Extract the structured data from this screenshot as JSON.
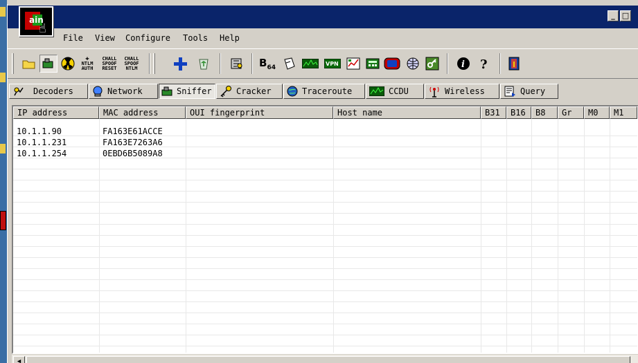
{
  "app": {
    "logo_text": "ain"
  },
  "window_buttons": {
    "minimize": "_",
    "maximize": "□"
  },
  "menu": [
    {
      "label": "File"
    },
    {
      "label": "View"
    },
    {
      "label": "Configure"
    },
    {
      "label": "Tools"
    },
    {
      "label": "Help"
    }
  ],
  "toolbar": {
    "ntlm_auth": [
      "NTLM",
      "AUTH"
    ],
    "chall_spoof_reset": [
      "CHALL",
      "SPOOF",
      "RESET"
    ],
    "chall_spoof_ntlm": [
      "CHALL",
      "SPOOF",
      "NTLM"
    ],
    "base64_label": "B",
    "base64_sub": "64"
  },
  "tabs": [
    {
      "label": "Decoders"
    },
    {
      "label": "Network"
    },
    {
      "label": "Sniffer",
      "active": true
    },
    {
      "label": "Cracker"
    },
    {
      "label": "Traceroute"
    },
    {
      "label": "CCDU"
    },
    {
      "label": "Wireless"
    },
    {
      "label": "Query"
    }
  ],
  "table": {
    "columns": [
      "IP address",
      "MAC address",
      "OUI fingerprint",
      "Host name",
      "B31",
      "B16",
      "B8",
      "Gr",
      "M0",
      "M1"
    ],
    "rows": [
      {
        "ip": "10.1.1.90",
        "mac": "FA163E61ACCE"
      },
      {
        "ip": "10.1.1.231",
        "mac": "FA163E7263A6"
      },
      {
        "ip": "10.1.1.254",
        "mac": "0EBD6B5089A8"
      }
    ]
  },
  "scrollbar": {
    "left_arrow": "◀"
  },
  "colors": {
    "titlebar": "#0a246a",
    "window": "#d4d0c8",
    "desktop": "#3a6ea5"
  }
}
